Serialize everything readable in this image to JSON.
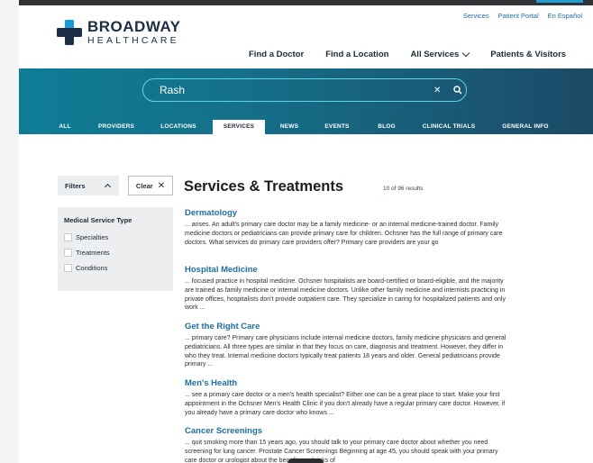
{
  "utility_nav": [
    "Services",
    "Patient Portal",
    "En Español"
  ],
  "logo": {
    "main": "BROADWAY",
    "sub": "HEALTHCARE"
  },
  "main_nav": [
    {
      "label": "Find a Doctor"
    },
    {
      "label": "Find a Location"
    },
    {
      "label": "All Services"
    },
    {
      "label": "Patients & Visitors"
    }
  ],
  "search": {
    "value": "Rash"
  },
  "tabs": [
    {
      "label": "ALL",
      "active": false
    },
    {
      "label": "PROVIDERS",
      "active": false
    },
    {
      "label": "LOCATIONS",
      "active": false
    },
    {
      "label": "SERVICES",
      "active": true
    },
    {
      "label": "NEWS",
      "active": false
    },
    {
      "label": "EVENTS",
      "active": false
    },
    {
      "label": "BLOG",
      "active": false
    },
    {
      "label": "CLINICAL TRIALS",
      "active": false
    },
    {
      "label": "GENERAL INFO",
      "active": false
    }
  ],
  "filters": {
    "label": "Filters",
    "clear_label": "Clear",
    "group_title": "Medical Service Type",
    "options": [
      "Specialties",
      "Treatments",
      "Conditions"
    ]
  },
  "results": {
    "title": "Services & Treatments",
    "count": "10 of 96 results",
    "items": [
      {
        "title": "Dermatology",
        "snippet": "... arises. An adult's primary care doctor may be a family medicine- or an internal medicine-trained doctor. Family medicine doctors or pediatricians can provide primary care for children. Ochsner has the full range of primary care doctors. What services do primary care providers offer? Primary care providers are your go"
      },
      {
        "title": "Hospital Medicine",
        "snippet": "... focused practice in hospital medicine. Ochsner hospitalists are board-certified or board-eligible, and the majority are trained as family medicine or internal medicine doctors. Unlike other family medicine and internists practicing in private offices, hospitalists don't provide outpatient care. They specialize in caring for hospitalized patients and only work ..."
      },
      {
        "title": "Get the Right Care",
        "snippet": "... primary care? Primary care physicians include internal medicine doctors, family medicine physicians and general pediatricians. All three types are similar in that they focus on care, diagnosis and treatment. However, they differ in who they treat. Internal medicine doctors typically treat patients 18 years and older. General pediatricians provide primary ..."
      },
      {
        "title": "Men's Health",
        "snippet": "... see a primary care doctor or a men's health specialist? Either one can be a great place to start. Make your first appointment in the Ochsner Men's Health Clinic if you don't already have a regular primary care doctor. However, if you already have a primary care doctor who knows ..."
      },
      {
        "title": "Cancer Screenings",
        "snippet": "... quit smoking more than 15 years ago, you should talk to your primary care doctor about whether you need screening for lung cancer. Prostate Cancer Screenings Beginning at age 45, you should speak with your primary care doctor or urologist about the benefits and risks of"
      }
    ]
  },
  "colors": {
    "brand_navy": "#1c2e45",
    "link_blue": "#1d6fa8",
    "hero_teal": "#0f7d96",
    "search_border": "#5fd3ec"
  }
}
